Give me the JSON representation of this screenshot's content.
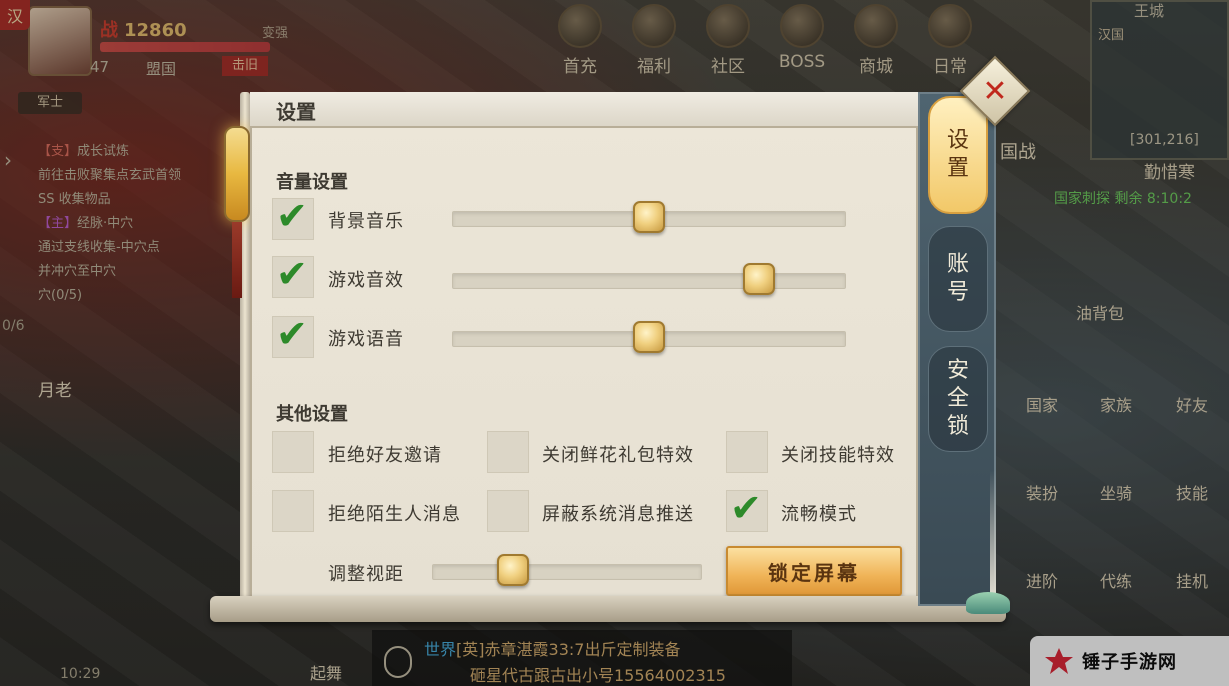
{
  "hud": {
    "server_badge": "汉",
    "power_icon": "战",
    "power_value": "12860",
    "level": "47",
    "alliance": "盟国",
    "flag": "击旧",
    "upgrade_tag": "变强",
    "rank_tag": "军士"
  },
  "quests": [
    {
      "type": "【支】",
      "name": "成长试炼",
      "desc": "前往击败聚集点玄武首领",
      "desc2": "SS 收集物品"
    },
    {
      "type": "【主】",
      "name": "经脉·中穴",
      "desc": "通过支线收集-中穴点",
      "desc2": "并冲穴至中穴",
      "counter": "穴(0/5)"
    }
  ],
  "quest_counter": "0/6",
  "npc_label": "月老",
  "topnav": [
    "首充",
    "福利",
    "社区",
    "BOSS",
    "商城",
    "日常"
  ],
  "minimap": {
    "title": "王城",
    "city": "汉国",
    "coords": "[301,216]",
    "location": "勤惜寒"
  },
  "guozhan_label": "国战",
  "country_event": "国家刺探 剩余 8:10:2",
  "right_menu": [
    "油背包",
    "国家",
    "家族",
    "好友",
    "装扮",
    "坐骑",
    "技能",
    "进阶",
    "代练",
    "挂机"
  ],
  "chat": {
    "channel": "世界",
    "badge": "[英]",
    "line1": "赤章湛霞33:7出斤定制装备",
    "line2": "砸星代古跟古出小号15564002315"
  },
  "time": "10:29",
  "qiwu_label": "起舞",
  "watermark": {
    "text": "锤子手游网"
  },
  "settings": {
    "title": "设置",
    "volume_section": "音量设置",
    "volume": [
      {
        "label": "背景音乐",
        "checked": true,
        "level": 0.5
      },
      {
        "label": "游戏音效",
        "checked": true,
        "level": 0.78
      },
      {
        "label": "游戏语音",
        "checked": true,
        "level": 0.5
      }
    ],
    "other_section": "其他设置",
    "options": [
      {
        "label": "拒绝好友邀请",
        "checked": false
      },
      {
        "label": "关闭鲜花礼包特效",
        "checked": false
      },
      {
        "label": "关闭技能特效",
        "checked": false
      },
      {
        "label": "拒绝陌生人消息",
        "checked": false
      },
      {
        "label": "屏蔽系统消息推送",
        "checked": false
      },
      {
        "label": "流畅模式",
        "checked": true
      }
    ],
    "view_distance_label": "调整视距",
    "view_distance_level": 0.3,
    "lock_button": "锁定屏幕",
    "tabs": [
      "设置",
      "账号",
      "安全锁"
    ],
    "active_tab": "设置",
    "check_glyph": "✔",
    "close_glyph": "✕"
  },
  "colors": {
    "accent": "#2d8a2a",
    "panel": "#ece6d8",
    "button": "#f0b458",
    "tab_bg": "#4f6470"
  }
}
